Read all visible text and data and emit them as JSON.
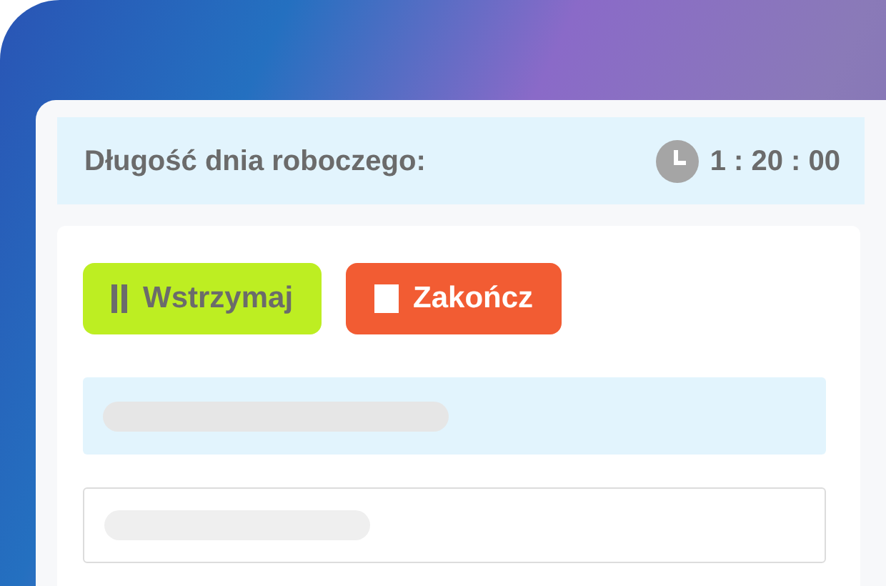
{
  "header": {
    "title": "Długość dnia roboczego:",
    "time": "1 : 20 : 00"
  },
  "buttons": [
    {
      "kind": "pause",
      "label": "Wstrzymaj"
    },
    {
      "kind": "stop",
      "label": "Zakończ"
    }
  ],
  "rows": [
    {
      "kind": "highlighted"
    },
    {
      "kind": "outlined"
    }
  ]
}
